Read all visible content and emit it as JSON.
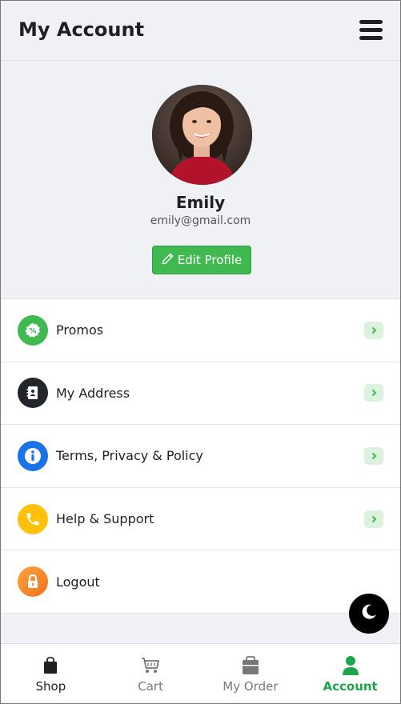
{
  "header": {
    "title": "My Account",
    "menu_icon": "hamburger-icon"
  },
  "profile": {
    "name": "Emily",
    "email": "emily@gmail.com",
    "edit_label": "Edit Profile",
    "edit_icon": "pencil-icon"
  },
  "menu": {
    "items": [
      {
        "label": "Promos",
        "icon": "discount-icon",
        "color": "#3fb950"
      },
      {
        "label": "My Address",
        "icon": "address-book-icon",
        "color": "#23262b"
      },
      {
        "label": "Terms, Privacy & Policy",
        "icon": "info-icon",
        "color": "#1a73e8"
      },
      {
        "label": "Help & Support",
        "icon": "phone-icon",
        "color": "#ffc107"
      },
      {
        "label": "Logout",
        "icon": "lock-icon",
        "color": "#f57c1f"
      }
    ],
    "chevron_icon": "chevron-right-icon"
  },
  "theme_toggle": {
    "icon": "moon-icon"
  },
  "tabbar": {
    "tabs": [
      {
        "label": "Shop",
        "icon": "shopping-bag-icon",
        "active": false
      },
      {
        "label": "Cart",
        "icon": "cart-icon",
        "active": false
      },
      {
        "label": "My Order",
        "icon": "order-icon",
        "active": false
      },
      {
        "label": "Account",
        "icon": "user-icon",
        "active": true
      }
    ]
  },
  "colors": {
    "accent": "#3fb950",
    "text": "#1f2023",
    "inactive": "#777777"
  }
}
